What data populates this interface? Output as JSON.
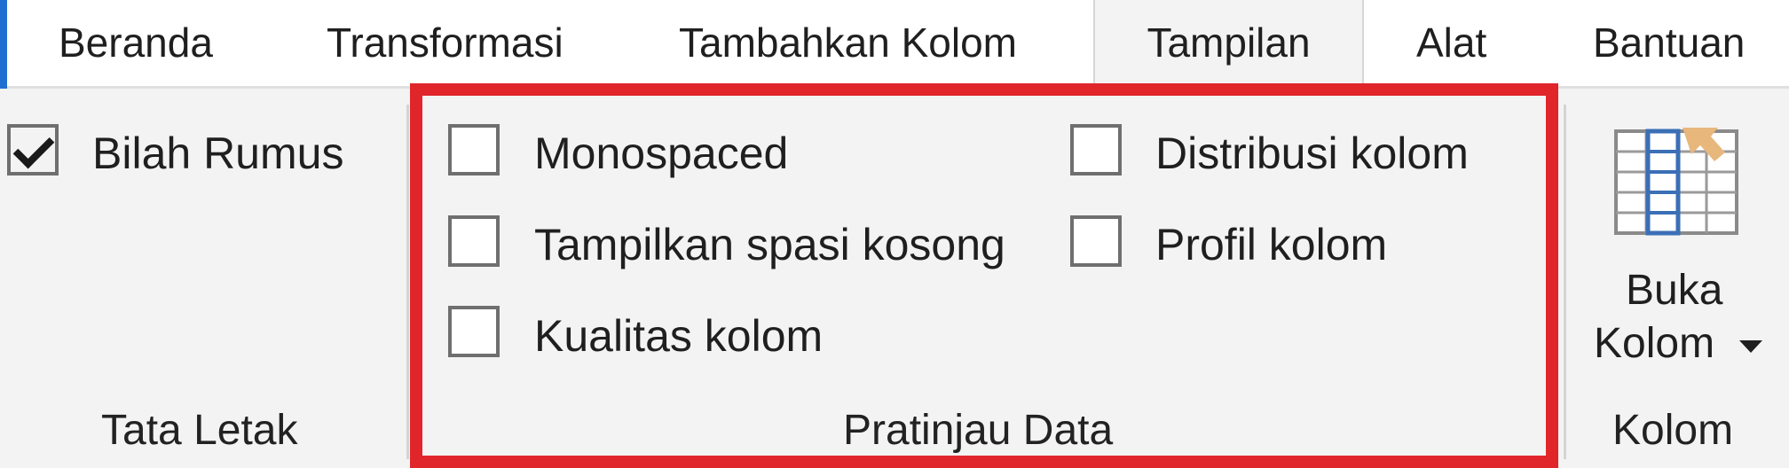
{
  "tabs": [
    "Beranda",
    "Transformasi",
    "Tambahkan Kolom",
    "Tampilan",
    "Alat",
    "Bantuan"
  ],
  "active_tab": "Tampilan",
  "colors": {
    "accent": "#1f6fd1",
    "highlight": "#e0262b",
    "grid_blue": "#3b6fb6",
    "cursor": "#e8b77c"
  },
  "groups": {
    "layout": {
      "label": "Tata Letak",
      "options": [
        {
          "label": "Bilah Rumus",
          "checked": true
        }
      ]
    },
    "preview": {
      "label": "Pratinjau Data",
      "options": [
        {
          "label": "Monospaced",
          "checked": false
        },
        {
          "label": "Tampilkan spasi kosong",
          "checked": false
        },
        {
          "label": "Kualitas kolom",
          "checked": false
        },
        {
          "label": "Distribusi kolom",
          "checked": false
        },
        {
          "label": "Profil kolom",
          "checked": false
        }
      ]
    },
    "columns": {
      "label": "Kolom",
      "button": {
        "line1": "Buka",
        "line2": "Kolom",
        "icon": "go-to-column-icon",
        "dropdown_icon": "caret-down-icon"
      }
    }
  }
}
